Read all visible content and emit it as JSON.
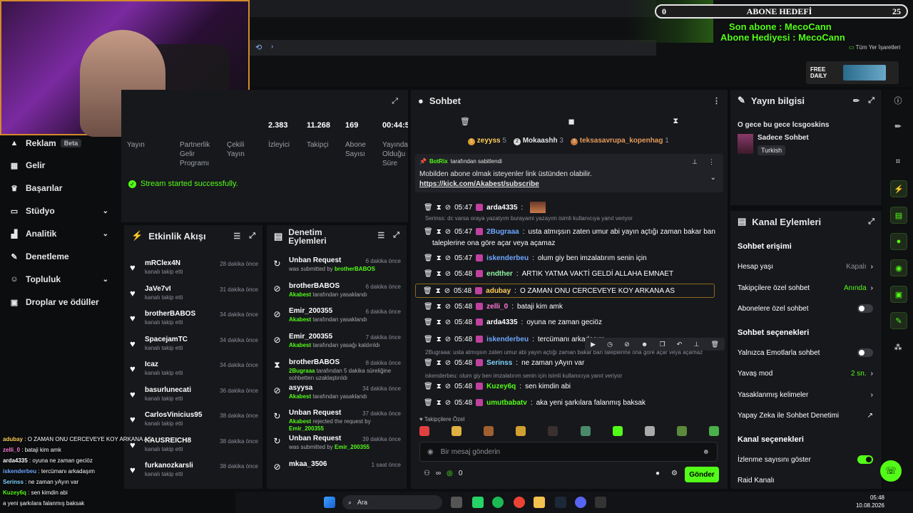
{
  "overlay_top": {
    "goal_current": "0",
    "goal_label": "ABONE HEDEFİ",
    "goal_target": "25",
    "last_sub": "Son abone : MecoCann",
    "last_gift": "Abone Hediyesi : MecoCann",
    "all_places": "Tüm Yer İşaretleri",
    "free_daily": "FREE DAILY"
  },
  "sidebar": {
    "items": [
      {
        "label": "Reklam",
        "badge": "Beta"
      },
      {
        "label": "Gelir"
      },
      {
        "label": "Başarılar"
      },
      {
        "label": "Stüdyo"
      },
      {
        "label": "Analitik"
      },
      {
        "label": "Denetleme"
      },
      {
        "label": "Topluluk"
      },
      {
        "label": "Droplar ve ödüller"
      }
    ]
  },
  "stats": {
    "col1": "Yayın",
    "col2": "Partnerlik Gelir Programı",
    "col3": "Çekili Yayın",
    "viewers_value": "2.383",
    "viewers_label": "İzleyici",
    "followers_value": "11.268",
    "followers_label": "Takipçi",
    "subs_value": "169",
    "subs_label": "Abone Sayısı",
    "uptime_value": "00:44:5",
    "uptime_label": "Yayında Olduğu Süre",
    "stream_ok": "Stream started successfully."
  },
  "feed": {
    "title": "Etkinlik Akışı",
    "items": [
      {
        "name": "mRClex4N",
        "sub": "kanalı takip etti",
        "time": "28 dakika önce"
      },
      {
        "name": "JaVe7vI",
        "sub": "kanalı takip etti",
        "time": "31 dakika önce"
      },
      {
        "name": "brotherBABOS",
        "sub": "kanalı takip etti",
        "time": "34 dakika önce"
      },
      {
        "name": "SpacejamTC",
        "sub": "kanalı takip etti",
        "time": "34 dakika önce"
      },
      {
        "name": "Icaz",
        "sub": "kanalı takip etti",
        "time": "34 dakika önce"
      },
      {
        "name": "basurlunecati",
        "sub": "kanalı takip etti",
        "time": "36 dakika önce"
      },
      {
        "name": "CarlosVinicius95",
        "sub": "kanalı takip etti",
        "time": "38 dakika önce"
      },
      {
        "name": "KAUSREICH8",
        "sub": "kanalı takip etti",
        "time": "38 dakika önce"
      },
      {
        "name": "furkanozkarsli",
        "sub": "kanalı takip etti",
        "time": "38 dakika önce"
      }
    ]
  },
  "mod": {
    "title": "Denetim Eylemleri",
    "items": [
      {
        "name": "Unban Request",
        "pre": "",
        "sub": "was submitted by ",
        "who": "brotherBABOS",
        "time": "6 dakika önce"
      },
      {
        "name": "brotherBABOS",
        "pre": "Akabest",
        "sub": " tarafından yasaklandı",
        "who": "",
        "time": "6 dakika önce"
      },
      {
        "name": "Emir_200355",
        "pre": "Akabest",
        "sub": " tarafından yasaklandı",
        "who": "",
        "time": "6 dakika önce"
      },
      {
        "name": "Emir_200355",
        "pre": "Akabest",
        "sub": " tarafından yasağı kaldırıldı",
        "who": "",
        "time": "7 dakika önce"
      },
      {
        "name": "brotherBABOS",
        "pre": "2Bugraaa",
        "sub": " tarafından 5 dakika süreliğine sohbetten uzaklaştırıldı",
        "who": "",
        "time": "8 dakika önce"
      },
      {
        "name": "asyysa",
        "pre": "Akabest",
        "sub": " tarafından yasaklandı",
        "who": "",
        "time": "34 dakika önce"
      },
      {
        "name": "Unban Request",
        "pre": "Akabest",
        "sub": " rejected the request by ",
        "who": "Emir_200355",
        "time": "37 dakika önce"
      },
      {
        "name": "Unban Request",
        "pre": "",
        "sub": "was submitted by ",
        "who": "Emir_200355",
        "time": "39 dakika önce"
      },
      {
        "name": "mkaa_3506",
        "pre": "",
        "sub": "",
        "who": "",
        "time": "1 saat önce"
      }
    ]
  },
  "chat": {
    "title": "Sohbet",
    "leaders": [
      {
        "name": "zeyyss",
        "count": "5"
      },
      {
        "name": "Mokaashh",
        "count": "3"
      },
      {
        "name": "teksasavrupa_kopenhag",
        "count": "1"
      }
    ],
    "pinned_by": "BotRix",
    "pinned_suffix": "tarafından sabitlendi",
    "pinned_text": "Mobilden abone olmak isteyenler link üstünden olabilir.",
    "pinned_link": "https://kick.com/Akabest/subscribe",
    "reply1": "Serinss: dc varsa oraya yazatyım burayami yazayım isimli kullanıcıya yanıt veriyor",
    "reply2": "2Bugraaa: usta atmışsın zaten umur abi yayın açtığı zaman bakar ban taleplerine ona göre açar veya açamaz",
    "reply3": "iskenderbeu: olum giy ben imzalatırım senin için isimli kullanıcıya yanıt veriyor",
    "messages": [
      {
        "time": "05:47",
        "user": "arda4335",
        "color": "#ffffff",
        "text": ""
      },
      {
        "time": "05:47",
        "user": "2Bugraaa",
        "color": "#6ea8ff",
        "text": "usta atmışsın zaten umur abi yayın açtığı zaman bakar ban"
      },
      {
        "time": "",
        "user": "",
        "color": "#ffffff",
        "text": "taleplerine ona göre açar veya açamaz"
      },
      {
        "time": "05:47",
        "user": "iskenderbeu",
        "color": "#6ea8ff",
        "text": "olum giy ben imzalatırım senin için"
      },
      {
        "time": "05:48",
        "user": "endther",
        "color": "#8ef0a0",
        "text": "ARTIK YATMA VAKTİ GELDİ ALLAHA EMNAET"
      },
      {
        "time": "05:48",
        "user": "adubay",
        "color": "#ffcf5a",
        "text": "O ZAMAN ONU CERCEVEYE KOY ARKANA AS"
      },
      {
        "time": "05:48",
        "user": "zelli_0",
        "color": "#ff7bd6",
        "text": "bataji kim amk"
      },
      {
        "time": "05:48",
        "user": "arda4335",
        "color": "#ffffff",
        "text": "oyuna ne zaman geciöz"
      },
      {
        "time": "05:48",
        "user": "iskenderbeu",
        "color": "#6ea8ff",
        "text": "tercümanı arkadaşım"
      },
      {
        "time": "05:48",
        "user": "Serinss",
        "color": "#7fd3ff",
        "text": "ne zaman yAyın var"
      },
      {
        "time": "05:48",
        "user": "Kuzey6q",
        "color": "#53fc18",
        "text": "sen kimdin abi"
      },
      {
        "time": "05:48",
        "user": "umutbabatv",
        "color": "#53fc18",
        "text": "aka yeni şarkılara falanmış baksak"
      }
    ],
    "followers_only": "Takipçilere Özel",
    "input_placeholder": "Bir mesaj gönderin",
    "count": "0",
    "send": "Gönder"
  },
  "info": {
    "title": "Yayın bilgisi",
    "stream_title": "O gece bu gece lcsgoskins",
    "category": "Sadece Sohbet",
    "tag": "Turkish"
  },
  "actions": {
    "title": "Kanal Eylemleri",
    "h1": "Sohbet erişimi",
    "r1": "Hesap yaşı",
    "r1v": "Kapalı",
    "r2": "Takipçilere özel sohbet",
    "r2v": "Anında",
    "r3": "Abonelere özel sohbet",
    "h2": "Sohbet seçenekleri",
    "r4": "Yalnızca Emotlarla sohbet",
    "r5": "Yavaş mod",
    "r5v": "2 sn.",
    "r6": "Yasaklanmış kelimeler",
    "r7": "Yapay Zeka ile Sohbet Denetimi",
    "h3": "Kanal seçenekleri",
    "r8": "İzlenme sayısını göster",
    "r9": "Raid Kanalı"
  },
  "overlay_chat": [
    {
      "user": "adubay",
      "color": "#ffcf5a",
      "text": "O ZAMAN ONU CERCEVEYE KOY ARKANA AS"
    },
    {
      "user": "zelli_0",
      "color": "#ff7bd6",
      "text": "bataji kim amk"
    },
    {
      "user": "arda4335",
      "color": "#ffffff",
      "text": "oyuna ne zaman geciöz"
    },
    {
      "user": "iskenderbeu",
      "color": "#6ea8ff",
      "text": "tercümanı arkadaşım"
    },
    {
      "user": "Serinss",
      "color": "#7fd3ff",
      "text": "ne zaman yAyın var"
    },
    {
      "user": "Kuzey6q",
      "color": "#53fc18",
      "text": "sen kimdin abi"
    },
    {
      "user": "",
      "color": "#ffffff",
      "text": "a yeni şarkılara falanmış baksak"
    }
  ],
  "taskbar": {
    "search": "Ara",
    "time": "05:48",
    "date": "10.08.2026"
  }
}
